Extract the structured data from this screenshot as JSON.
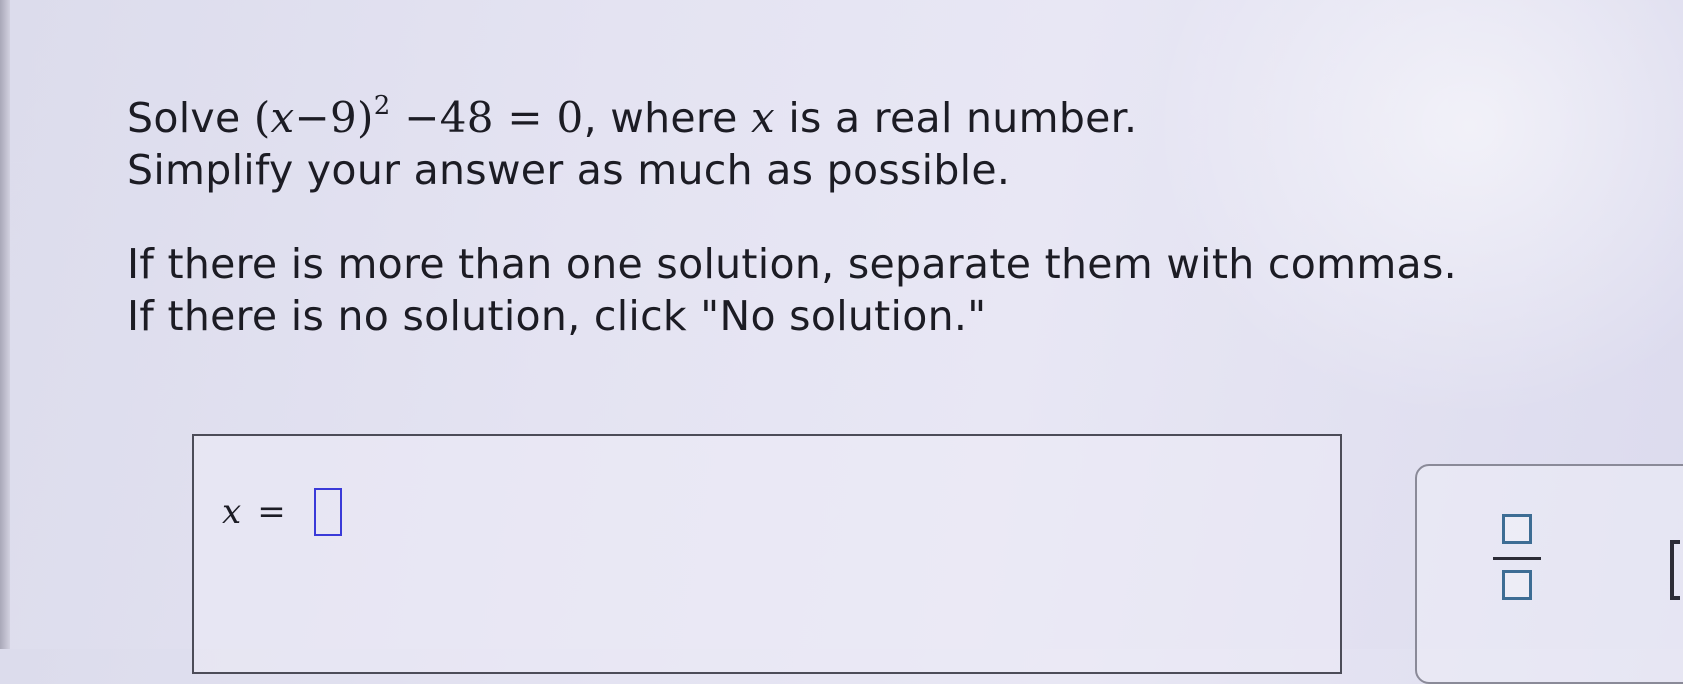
{
  "question": {
    "line1": {
      "prefix": "Solve ",
      "open_paren": "(",
      "var": "x",
      "minus1": "−",
      "nine": "9",
      "close_paren": ")",
      "exponent": "2",
      "rest": " −48 = 0",
      "middle": ", where ",
      "var2": "x",
      "suffix": " is a real number."
    },
    "line2": "Simplify your answer as much as possible.",
    "line3": "If there is more than one solution, separate them with commas.",
    "line4": "If there is no solution, click \"No solution.\""
  },
  "answer": {
    "variable": "x",
    "equals": "=",
    "value": ""
  },
  "toolbar": {
    "fraction_icon": "fraction-template-icon"
  }
}
